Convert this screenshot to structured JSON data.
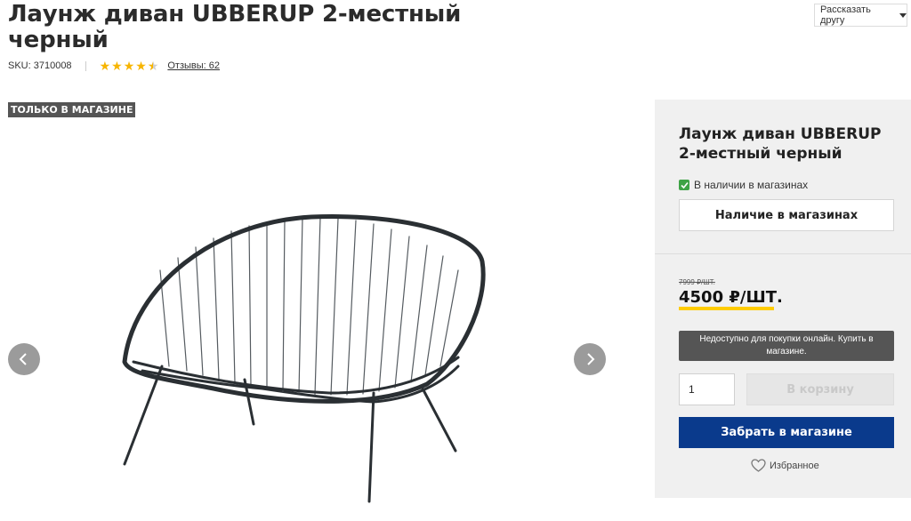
{
  "product": {
    "title": "Лаунж диван UBBERUP 2-местный черный",
    "sku": "SKU: 3710008",
    "rating": 4.5,
    "reviews": "Отзывы: 62",
    "badge": "ТОЛЬКО В МАГАЗИНЕ"
  },
  "header": {
    "share_label": "Рассказать другу"
  },
  "panel": {
    "title": "Лаунж диван UBBERUP 2-местный черный",
    "stock_text": "В наличии в магазинах",
    "availability_button": "Наличие в магазинах",
    "old_price": "7999 ₽/ШТ.",
    "price": "4500 ₽/ШТ.",
    "notice": "Недоступно для покупки онлайн. Купить в магазине.",
    "quantity": "1",
    "cart_button": "В корзину",
    "pickup_button": "Забрать в магазине",
    "favorite_label": "Избранное"
  },
  "icons": [
    "star-icon",
    "chevron-left-icon",
    "chevron-right-icon",
    "check-icon",
    "heart-icon",
    "caret-down-icon"
  ],
  "colors": {
    "accent_blue": "#0a3a8c",
    "price_underline": "#ffcc00",
    "stock_green": "#3ea346",
    "star": "#f7b500"
  }
}
